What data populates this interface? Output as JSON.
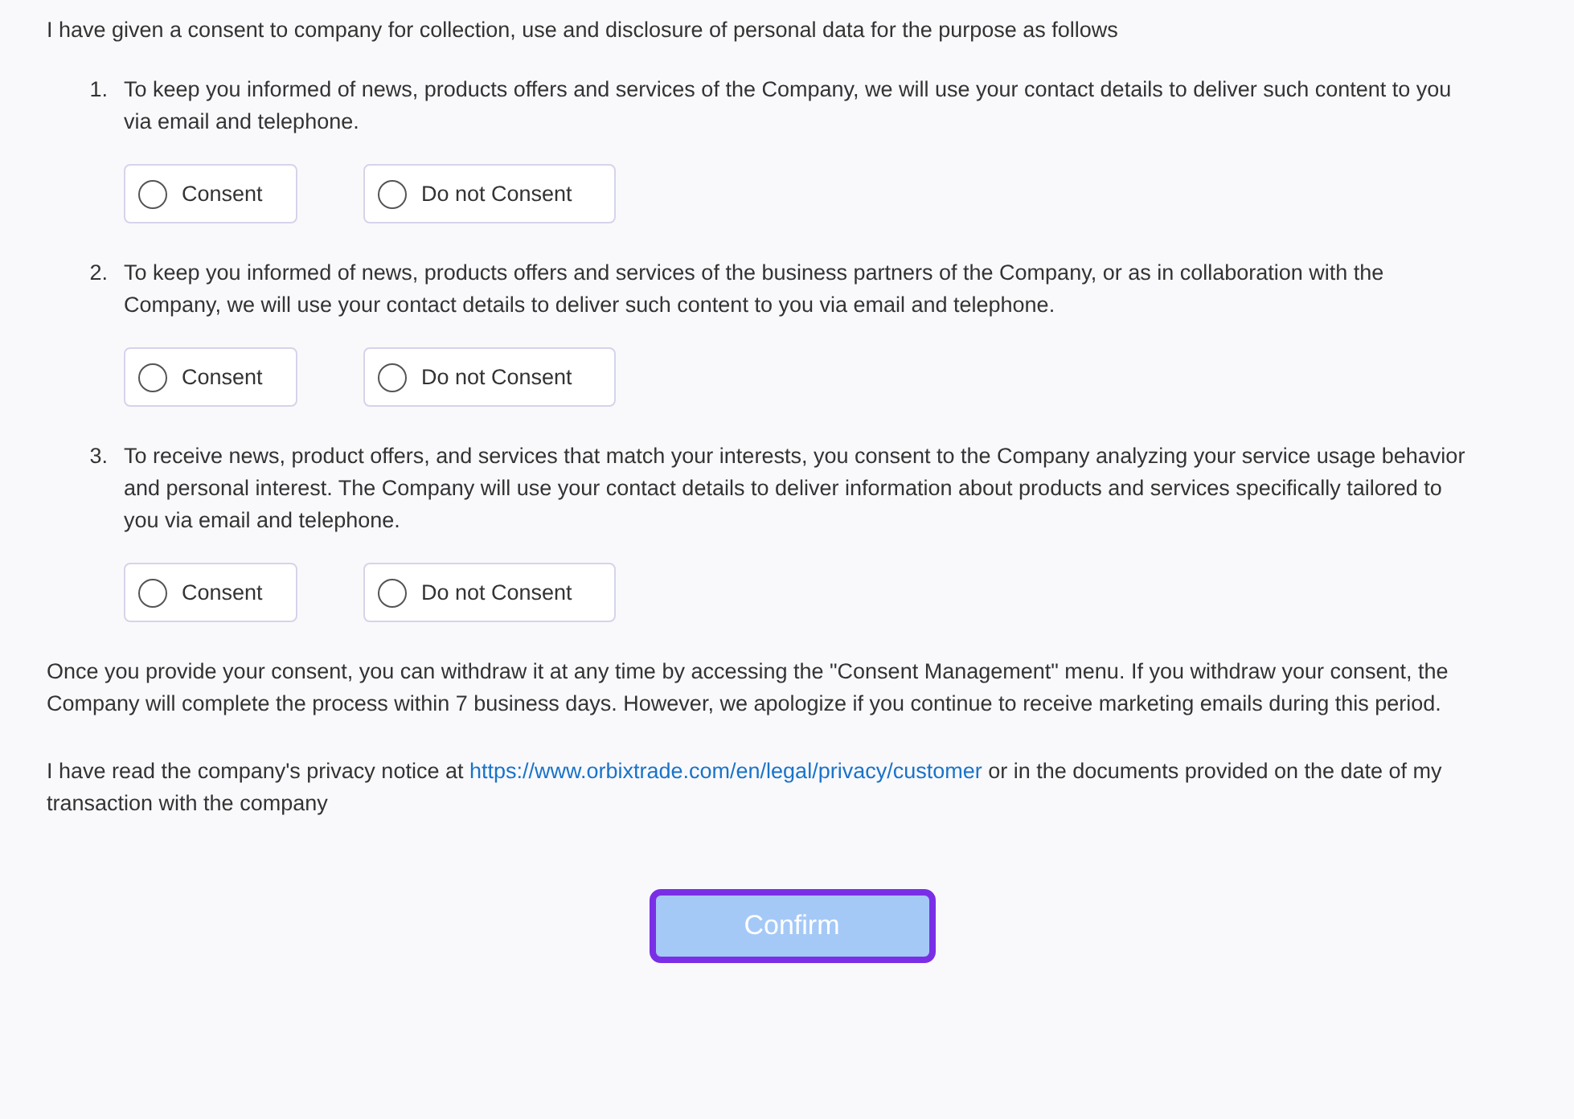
{
  "intro": "I have given a consent to company for collection, use and disclosure of personal data for the purpose as follows",
  "items": [
    {
      "number": "1.",
      "text": "To keep you informed of news, products offers and services of the Company, we will use your contact details to deliver such content to you via email and telephone.",
      "options": [
        {
          "label": "Consent",
          "selected": false
        },
        {
          "label": "Do not Consent",
          "selected": false
        }
      ]
    },
    {
      "number": "2.",
      "text": "To keep you informed of news, products offers and services of the business partners of the Company, or as in collaboration with the Company, we will use your contact details to deliver such content to you via email and telephone.",
      "options": [
        {
          "label": "Consent",
          "selected": false
        },
        {
          "label": "Do not Consent",
          "selected": false
        }
      ]
    },
    {
      "number": "3.",
      "text": "To receive news, product offers, and services that match your interests, you consent to the Company analyzing your service usage behavior and personal interest. The Company will use your contact details to deliver information about products and services specifically tailored to you via email and telephone.",
      "options": [
        {
          "label": "Consent",
          "selected": false
        },
        {
          "label": "Do not Consent",
          "selected": false
        }
      ]
    }
  ],
  "withdraw_note": "Once you provide your consent, you can withdraw it at any time by accessing the \"Consent Management\" menu. If you withdraw your consent, the Company will complete the process within 7 business days. However, we apologize if you continue to receive marketing emails during this period.",
  "privacy": {
    "before": "I have read the company's privacy notice at ",
    "link": "https://www.orbixtrade.com/en/legal/privacy/customer",
    "after": " or in the documents provided on the date of my transaction with the company"
  },
  "confirm": {
    "label": "Confirm",
    "disabled": true
  }
}
